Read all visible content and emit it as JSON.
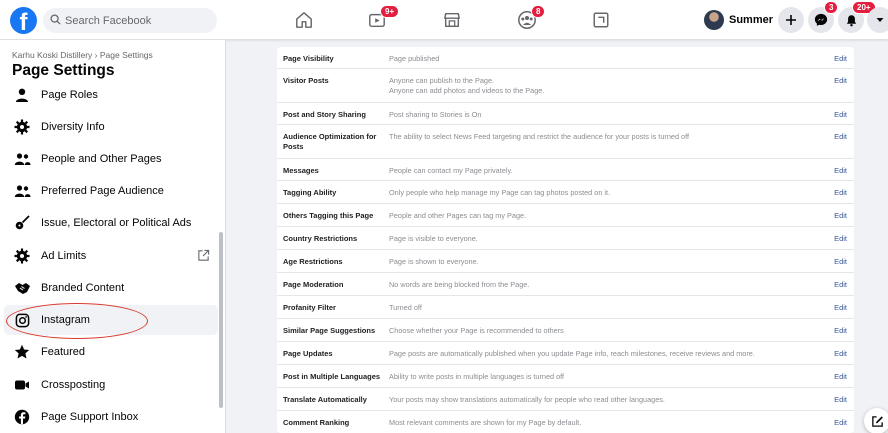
{
  "topbar": {
    "logo": "f",
    "search_placeholder": "Search Facebook",
    "nav": [
      {
        "icon": "home-icon",
        "badge": ""
      },
      {
        "icon": "watch-icon",
        "badge": "9+"
      },
      {
        "icon": "marketplace-icon",
        "badge": ""
      },
      {
        "icon": "groups-icon",
        "badge": "8"
      },
      {
        "icon": "gaming-icon",
        "badge": ""
      }
    ],
    "profile_name": "Summer",
    "messenger_badge": "3",
    "notifications_badge": "20+"
  },
  "sidebar": {
    "breadcrumb": "Karhu Koski Distillery › Page Settings",
    "title": "Page Settings",
    "items": [
      {
        "label": "Page Roles",
        "icon": "person-icon"
      },
      {
        "label": "Diversity Info",
        "icon": "gear-icon"
      },
      {
        "label": "People and Other Pages",
        "icon": "people-icon"
      },
      {
        "label": "Preferred Page Audience",
        "icon": "people-icon"
      },
      {
        "label": "Issue, Electoral or Political Ads",
        "icon": "guitar-icon"
      },
      {
        "label": "Ad Limits",
        "icon": "gear-icon"
      },
      {
        "label": "Branded Content",
        "icon": "handshake-icon"
      },
      {
        "label": "Instagram",
        "icon": "instagram-icon"
      },
      {
        "label": "Featured",
        "icon": "star-icon"
      },
      {
        "label": "Crossposting",
        "icon": "video-camera-icon"
      },
      {
        "label": "Page Support Inbox",
        "icon": "facebook-icon"
      }
    ],
    "active_item": "Instagram"
  },
  "settings": {
    "edit_label": "Edit",
    "rows": [
      {
        "label": "Page Visibility",
        "value": "Page published",
        "value2": ""
      },
      {
        "label": "Visitor Posts",
        "value": "Anyone can publish to the Page.",
        "value2": "Anyone can add photos and videos to the Page."
      },
      {
        "label": "Post and Story Sharing",
        "value": "Post sharing to Stories is On",
        "value2": ""
      },
      {
        "label": "Audience Optimization for Posts",
        "value": "The ability to select News Feed targeting and restrict the audience for your posts is turned off",
        "value2": ""
      },
      {
        "label": "Messages",
        "value": "People can contact my Page privately.",
        "value2": ""
      },
      {
        "label": "Tagging Ability",
        "value": "Only people who help manage my Page can tag photos posted on it.",
        "value2": ""
      },
      {
        "label": "Others Tagging this Page",
        "value": "People and other Pages can tag my Page.",
        "value2": ""
      },
      {
        "label": "Country Restrictions",
        "value": "Page is visible to everyone.",
        "value2": ""
      },
      {
        "label": "Age Restrictions",
        "value": "Page is shown to everyone.",
        "value2": ""
      },
      {
        "label": "Page Moderation",
        "value": "No words are being blocked from the Page.",
        "value2": ""
      },
      {
        "label": "Profanity Filter",
        "value": "Turned off",
        "value2": ""
      },
      {
        "label": "Similar Page Suggestions",
        "value": "Choose whether your Page is recommended to others",
        "value2": ""
      },
      {
        "label": "Page Updates",
        "value": "Page posts are automatically published when you update Page info, reach milestones, receive reviews and more.",
        "value2": ""
      },
      {
        "label": "Post in Multiple Languages",
        "value": "Ability to write posts in multiple languages is turned off",
        "value2": ""
      },
      {
        "label": "Translate Automatically",
        "value": "Your posts may show translations automatically for people who read other languages.",
        "value2": ""
      },
      {
        "label": "Comment Ranking",
        "value": "Most relevant comments are shown for my Page by default.",
        "value2": ""
      }
    ]
  },
  "colors": {
    "brand": "#1877f2",
    "link": "#385898",
    "badge": "#e41e3f",
    "annotation": "#d9382c"
  }
}
